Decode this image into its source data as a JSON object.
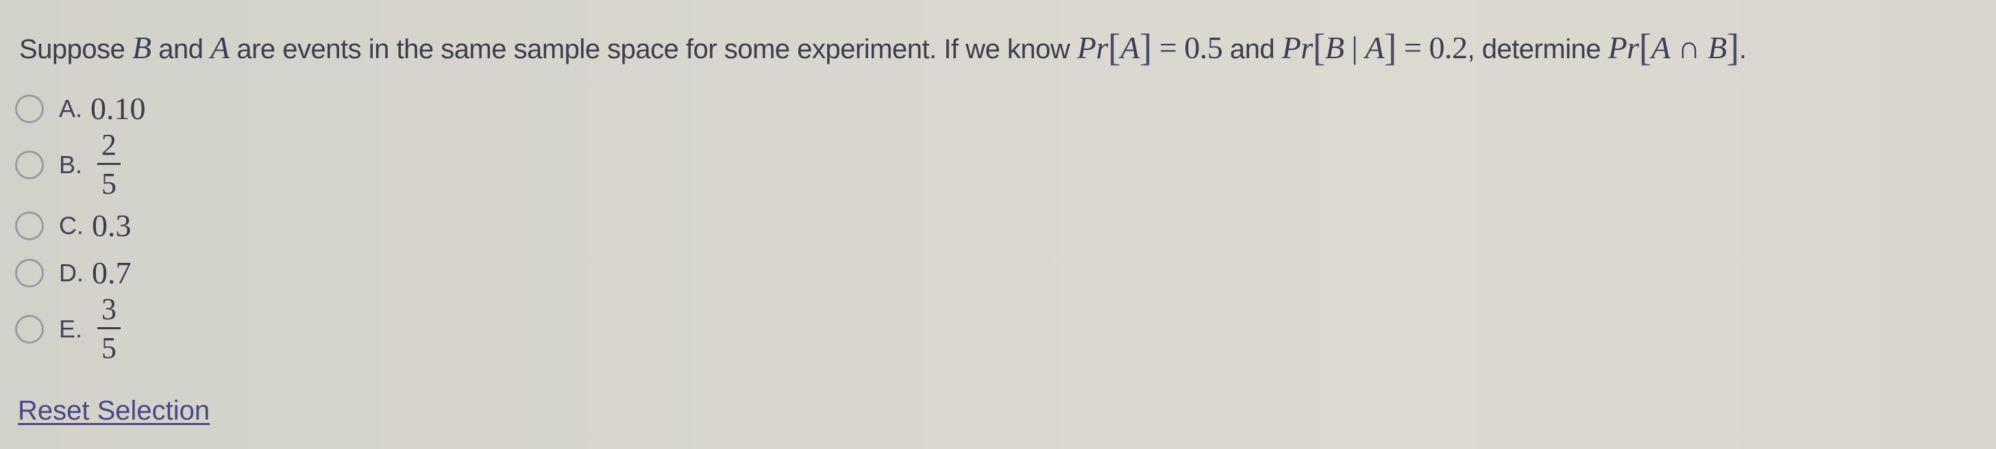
{
  "question": {
    "parts": {
      "p1": "Suppose ",
      "m1": "B",
      "p2": " and ",
      "m2": "A",
      "p3": " are events in the same sample space for some experiment. If we know ",
      "m3_func": "Pr",
      "m3_arg": "A",
      "m3_eq": " = 0.5",
      "p4": " and ",
      "m4_func": "Pr",
      "m4_arg1": "B",
      "m4_bar": " | ",
      "m4_arg2": "A",
      "m4_eq": " = 0.2",
      "p5": ", determine ",
      "m5_func": "Pr",
      "m5_arg1": "A",
      "m5_cap": " ∩ ",
      "m5_arg2": "B",
      "p6": "."
    },
    "full_text": "Suppose B and A are events in the same sample space for some experiment. If we know Pr[A] = 0.5 and Pr[B | A] = 0.2, determine Pr[A ∩ B]."
  },
  "options": [
    {
      "letter": "A.",
      "value": "0.10",
      "selected": false
    },
    {
      "letter": "B.",
      "numerator": "2",
      "denominator": "5",
      "selected": false
    },
    {
      "letter": "C.",
      "value": "0.3",
      "selected": false
    },
    {
      "letter": "D.",
      "value": "0.7",
      "selected": false
    },
    {
      "letter": "E.",
      "numerator": "3",
      "denominator": "5",
      "selected": false
    }
  ],
  "reset_label": "Reset Selection",
  "colors": {
    "background": "#d8d6ce",
    "text": "#3b3e4b",
    "link": "#4a4789",
    "radio_border": "#9b9aa3"
  }
}
